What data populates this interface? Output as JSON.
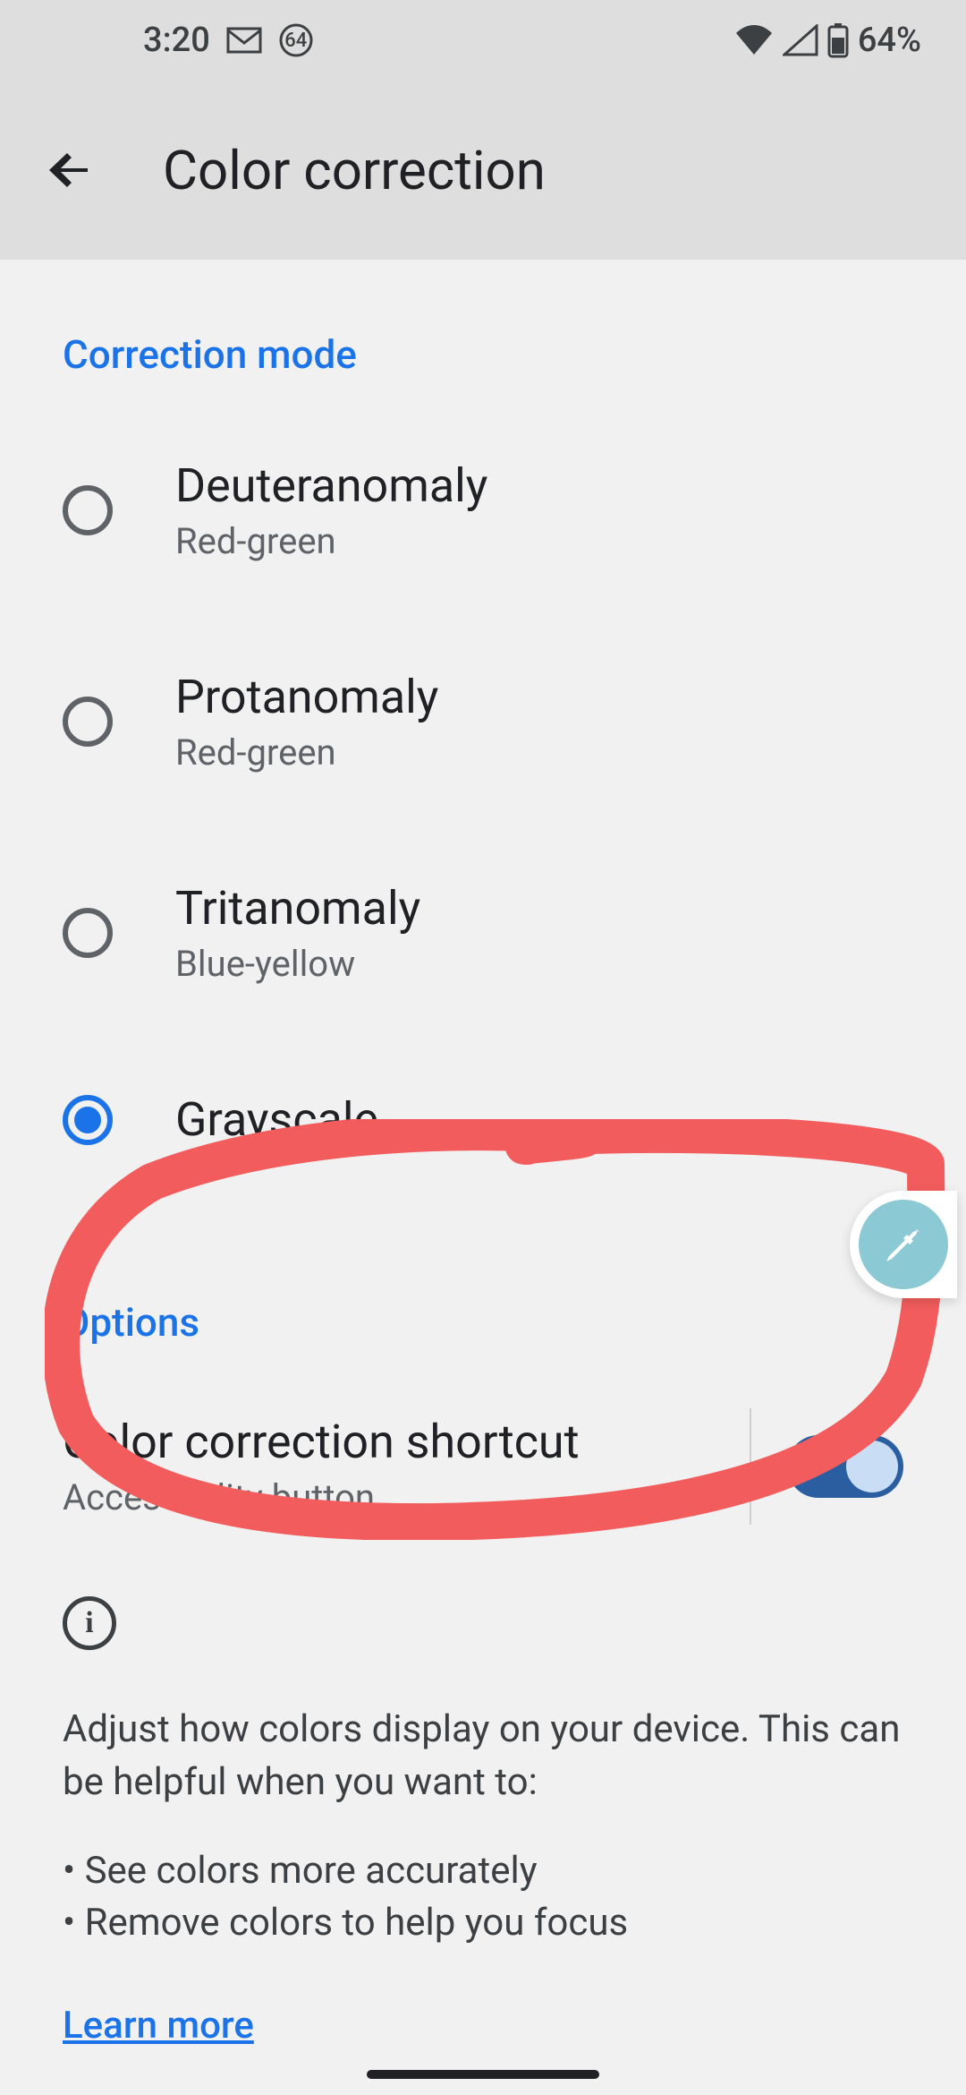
{
  "status": {
    "time": "3:20",
    "gmail_badge": "64",
    "battery_text": "64%"
  },
  "header": {
    "title": "Color correction"
  },
  "sections": {
    "correction_mode": "Correction mode",
    "options": "Options"
  },
  "modes": [
    {
      "title": "Deuteranomaly",
      "subtitle": "Red-green",
      "selected": false
    },
    {
      "title": "Protanomaly",
      "subtitle": "Red-green",
      "selected": false
    },
    {
      "title": "Tritanomaly",
      "subtitle": "Blue-yellow",
      "selected": false
    },
    {
      "title": "Grayscale",
      "subtitle": "",
      "selected": true
    }
  ],
  "shortcut": {
    "title": "Color correction shortcut",
    "subtitle": "Accessibility button",
    "enabled": true
  },
  "info": {
    "description": "Adjust how colors display on your device. This can be helpful when you want to:",
    "bullets": [
      "See colors more accurately",
      "Remove colors to help you focus"
    ],
    "learn_more": "Learn more"
  }
}
